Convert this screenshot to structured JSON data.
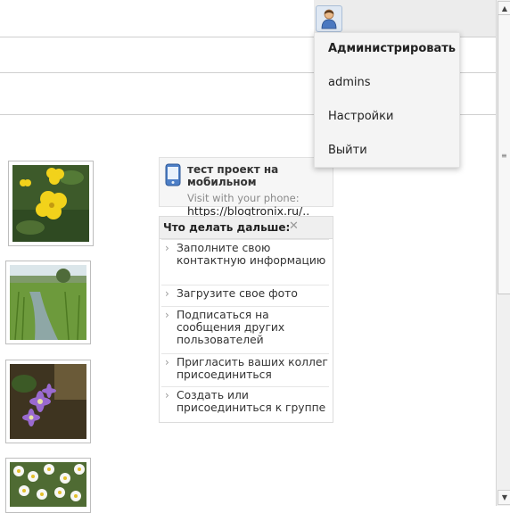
{
  "user_menu": {
    "items": [
      "Администрировать",
      "admins",
      "Настройки",
      "Выйти"
    ]
  },
  "mobile_box": {
    "title": "тест проект на мобильном",
    "visit_text": "Visit with your phone:",
    "url": "https://blogtronix.ru/.."
  },
  "next_steps": {
    "title": "Что делать дальше:",
    "close_glyph": "✕",
    "items": [
      "Заполните свою контактную информацию",
      "Загрузите свое фото",
      "Подписаться на сообщения других пользователей",
      "Пригласить ваших коллег присоединиться",
      "Создать или присоединиться к группе"
    ]
  },
  "icons": {
    "user": "user-icon",
    "phone": "mobile-phone-icon",
    "close": "close-icon",
    "chevron": "chevron-right-icon"
  }
}
